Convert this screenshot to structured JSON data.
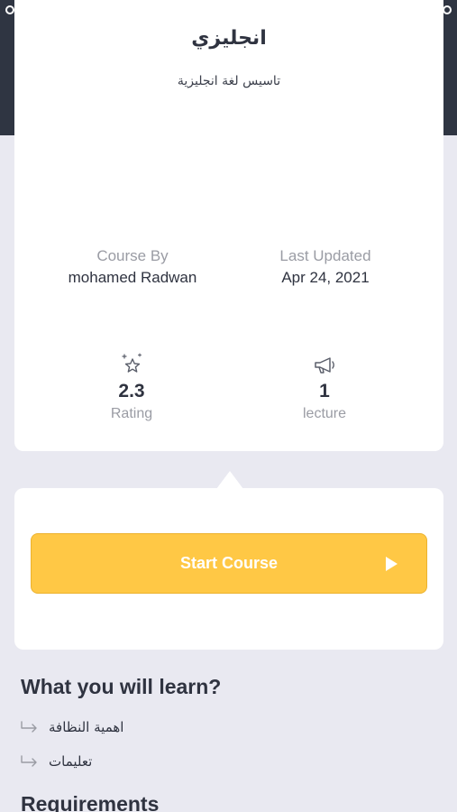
{
  "course": {
    "title": "انجليزي",
    "subtitle": "تاسيس لغة انجليزية"
  },
  "meta": {
    "course_by_label": "Course By",
    "course_by_value": "mohamed Radwan",
    "last_updated_label": "Last Updated",
    "last_updated_value": "Apr 24, 2021"
  },
  "stats": {
    "rating_value": "2.3",
    "rating_label": "Rating",
    "rating_icon": "sparkle-star-icon",
    "lecture_value": "1",
    "lecture_label": "lecture",
    "lecture_icon": "megaphone-icon"
  },
  "actions": {
    "start_label": "Start Course",
    "start_color": "#ffc845"
  },
  "learn": {
    "heading": "What you will learn?",
    "items": [
      "اهمية النظافة",
      "تعليمات"
    ]
  },
  "requirements": {
    "heading": "Requirements"
  },
  "colors": {
    "header_band": "#2f3542",
    "page_background": "#e9e9f1",
    "text_primary": "#2f3340",
    "text_muted": "#9a9ca4"
  }
}
